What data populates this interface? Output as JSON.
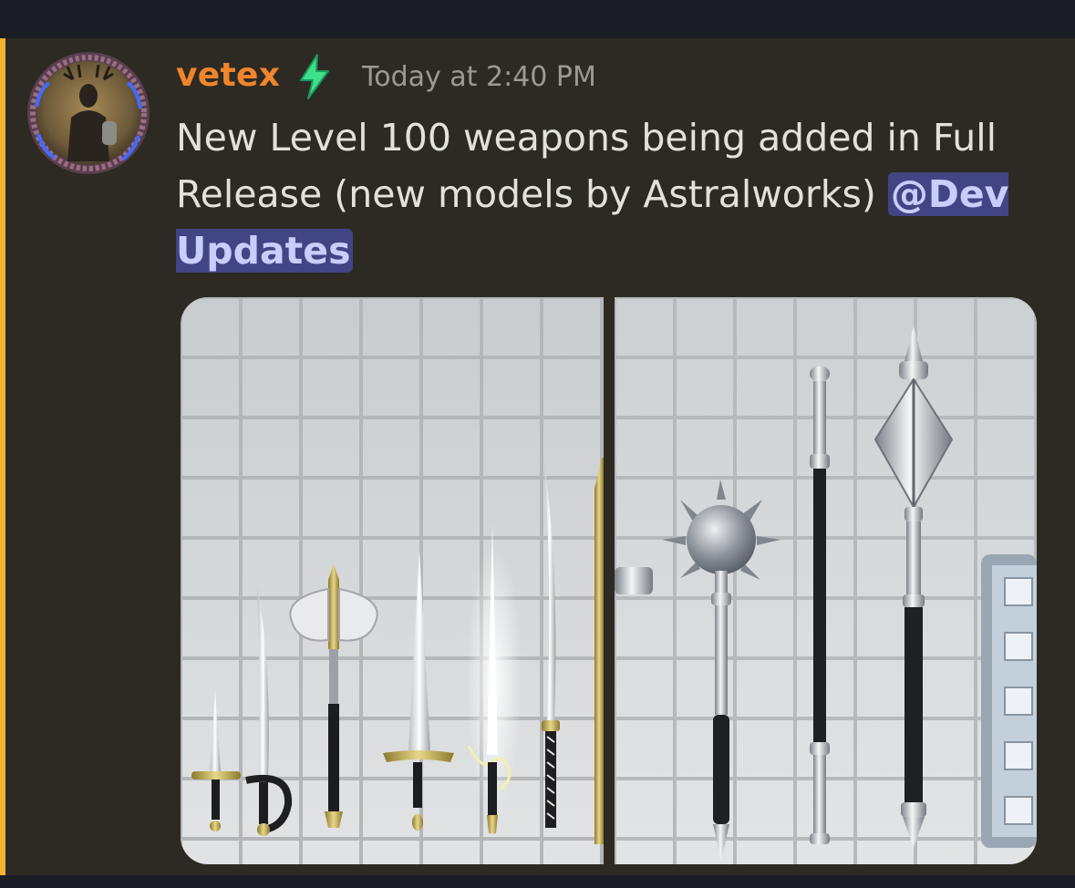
{
  "message": {
    "author": "vetex",
    "timestamp": "Today at 2:40 PM",
    "text": "New Level 100 weapons being added in Full Release (new models by Astralworks) ",
    "mention": "@Dev Updates"
  },
  "colors": {
    "accent_bar": "#f0b232",
    "username": "#f0852b",
    "mention_bg": "#414584",
    "mention_text": "#c9cdfb",
    "background": "#2d2a24"
  },
  "icons": {
    "author_badge": "lightning-bolt-icon",
    "avatar": "antlered-knight-avatar"
  }
}
